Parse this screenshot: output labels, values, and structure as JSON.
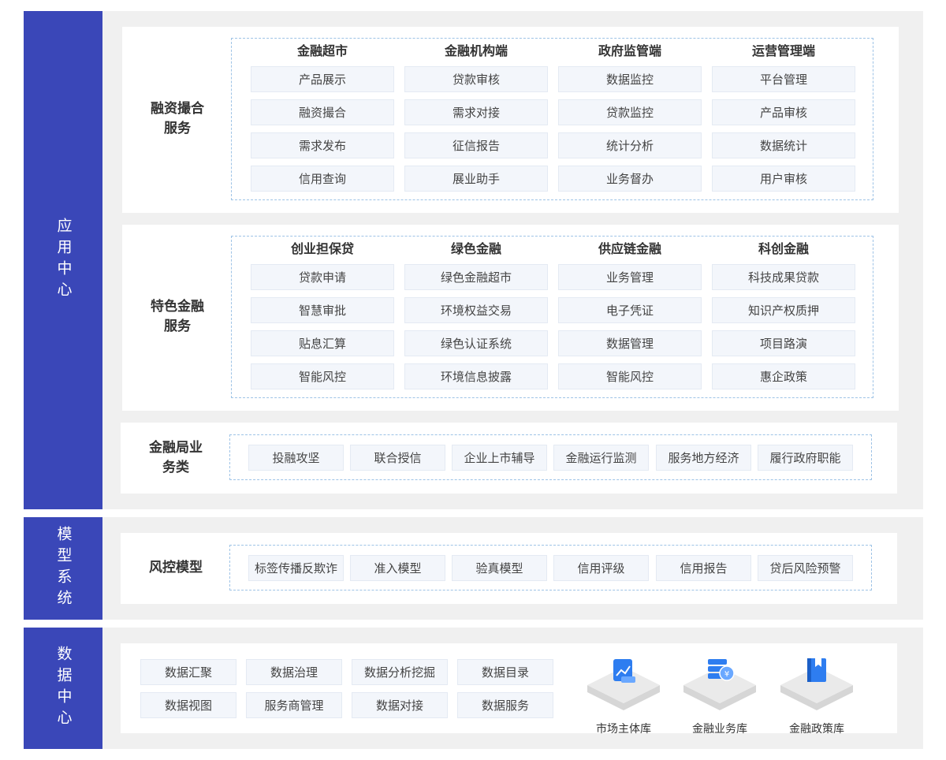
{
  "layers": {
    "app": "应用中心",
    "model": "模型系统",
    "data": "数据中心"
  },
  "financing": {
    "title_line1": "融资撮合",
    "title_line2": "服务",
    "columns": [
      {
        "head": "金融超市",
        "items": [
          "产品展示",
          "融资撮合",
          "需求发布",
          "信用查询"
        ]
      },
      {
        "head": "金融机构端",
        "items": [
          "贷款审核",
          "需求对接",
          "征信报告",
          "展业助手"
        ]
      },
      {
        "head": "政府监管端",
        "items": [
          "数据监控",
          "贷款监控",
          "统计分析",
          "业务督办"
        ]
      },
      {
        "head": "运营管理端",
        "items": [
          "平台管理",
          "产品审核",
          "数据统计",
          "用户审核"
        ]
      }
    ]
  },
  "special": {
    "title_line1": "特色金融",
    "title_line2": "服务",
    "columns": [
      {
        "head": "创业担保贷",
        "items": [
          "贷款申请",
          "智慧审批",
          "贴息汇算",
          "智能风控"
        ]
      },
      {
        "head": "绿色金融",
        "items": [
          "绿色金融超市",
          "环境权益交易",
          "绿色认证系统",
          "环境信息披露"
        ]
      },
      {
        "head": "供应链金融",
        "items": [
          "业务管理",
          "电子凭证",
          "数据管理",
          "智能风控"
        ]
      },
      {
        "head": "科创金融",
        "items": [
          "科技成果贷款",
          "知识产权质押",
          "项目路演",
          "惠企政策"
        ]
      }
    ]
  },
  "bureau": {
    "title_line1": "金融局业",
    "title_line2": "务类",
    "items": [
      "投融攻坚",
      "联合授信",
      "企业上市辅导",
      "金融运行监测",
      "服务地方经济",
      "履行政府职能"
    ]
  },
  "risk": {
    "title": "风控模型",
    "items": [
      "标签传播反欺诈",
      "准入模型",
      "验真模型",
      "信用评级",
      "信用报告",
      "贷后风险预警"
    ]
  },
  "data_center": {
    "items": [
      "数据汇聚",
      "数据治理",
      "数据分析挖掘",
      "数据目录",
      "数据视图",
      "服务商管理",
      "数据对接",
      "数据服务"
    ],
    "databases": [
      {
        "label": "市场主体库",
        "icon": "chart-document-icon"
      },
      {
        "label": "金融业务库",
        "icon": "coin-stack-icon"
      },
      {
        "label": "金融政策库",
        "icon": "book-icon"
      }
    ]
  },
  "colors": {
    "layer_label_bg": "#3a47b8",
    "icon_blue": "#2e7df0",
    "cell_bg": "#f3f6fb",
    "dash_border": "#9ec3e6"
  }
}
